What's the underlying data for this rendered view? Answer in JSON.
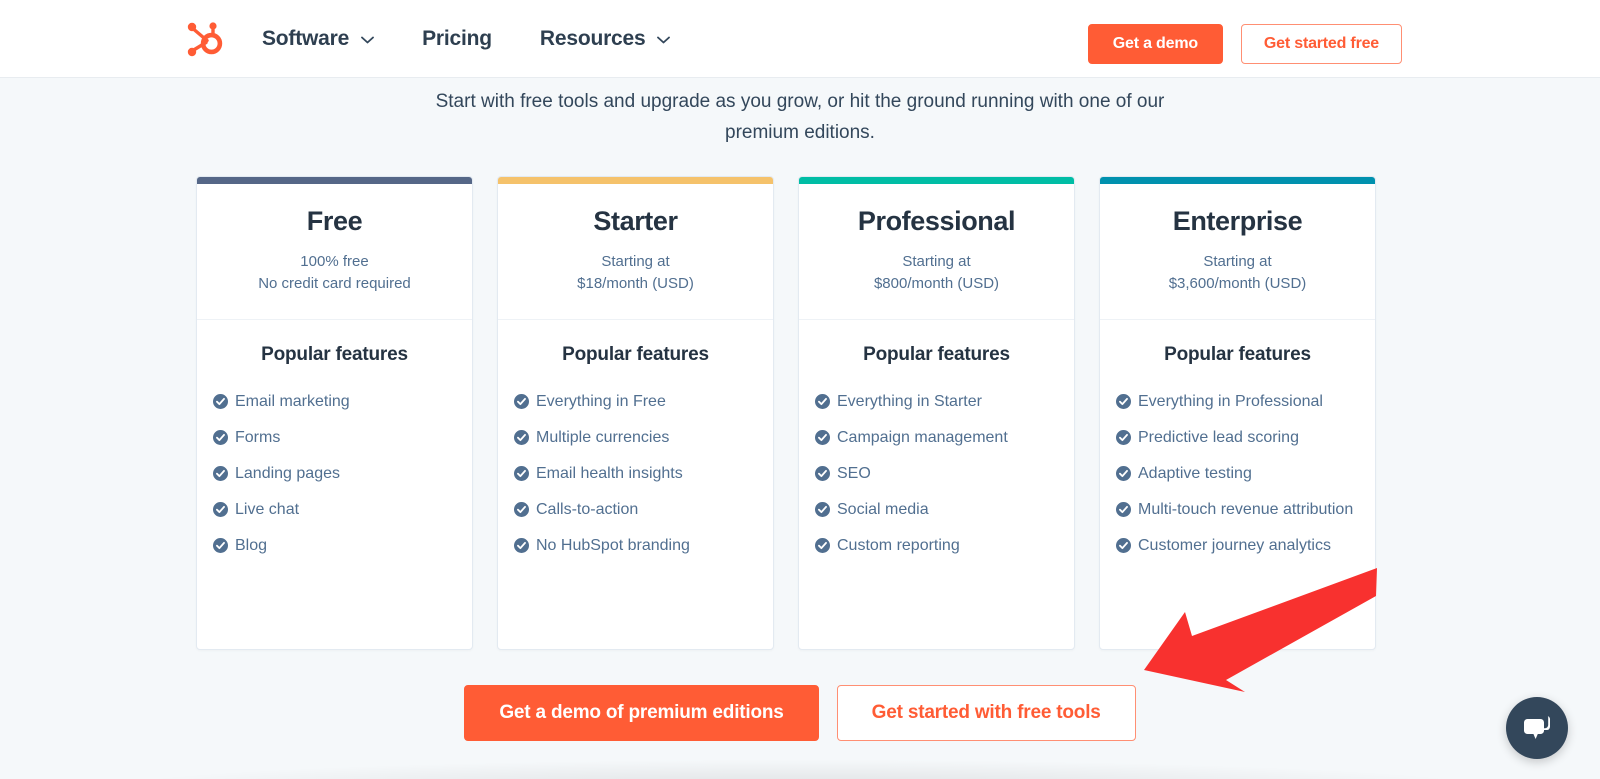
{
  "header": {
    "logo_name": "hubspot-sprocket-logo",
    "nav": [
      {
        "label": "Software",
        "has_dropdown": true
      },
      {
        "label": "Pricing",
        "has_dropdown": false
      },
      {
        "label": "Resources",
        "has_dropdown": true
      }
    ],
    "demo_button": "Get a demo",
    "free_button": "Get started free"
  },
  "main": {
    "subtitle": "Start with free tools and upgrade as you grow, or hit the ground running with one of our premium editions.",
    "features_heading": "Popular features",
    "cards": [
      {
        "name": "Free",
        "accent": "#556787",
        "price_top": "100% free",
        "price_bottom": "No credit card required",
        "features_heading": "Popular features",
        "features": [
          "Email marketing",
          "Forms",
          "Landing pages",
          "Live chat",
          "Blog"
        ]
      },
      {
        "name": "Starter",
        "accent": "#f5c26b",
        "price_top": "Starting at",
        "price_bottom": "$18/month (USD)",
        "features_heading": "Popular features",
        "features": [
          "Everything in Free",
          "Multiple currencies",
          "Email health insights",
          "Calls-to-action",
          "No HubSpot branding"
        ]
      },
      {
        "name": "Professional",
        "accent": "#00bda5",
        "price_top": "Starting at",
        "price_bottom": "$800/month (USD)",
        "features_heading": "Popular features",
        "features": [
          "Everything in Starter",
          "Campaign management",
          "SEO",
          "Social media",
          "Custom reporting"
        ]
      },
      {
        "name": "Enterprise",
        "accent": "#0091ae",
        "price_top": "Starting at",
        "price_bottom": "$3,600/month (USD)",
        "features_heading": "Popular features",
        "features": [
          "Everything in Professional",
          "Predictive lead scoring",
          "Adaptive testing",
          "Multi-touch revenue attribution",
          "Customer journey analytics"
        ]
      }
    ],
    "cta_primary": "Get a demo of premium editions",
    "cta_secondary": "Get started with free tools"
  },
  "overlay": {
    "arrow_name": "red-annotation-arrow",
    "arrow_color": "#f8312f"
  },
  "widgets": {
    "chat_button_name": "chat-widget-button"
  },
  "colors": {
    "brand_orange": "#ff5c35",
    "text_dark": "#253342",
    "text_muted": "#516f90",
    "page_bg": "#f5f8fa",
    "tick": "#516f90"
  }
}
